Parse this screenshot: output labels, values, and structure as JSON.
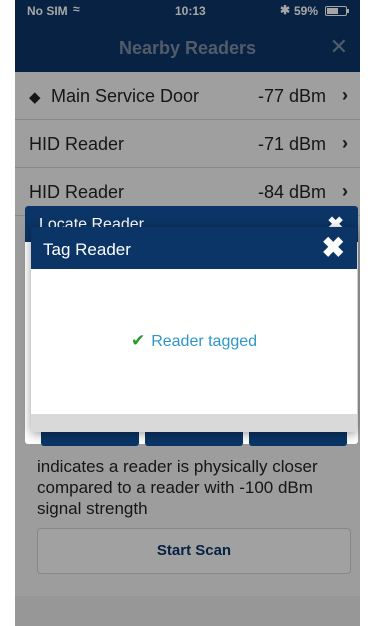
{
  "status_bar": {
    "carrier": "No SIM",
    "wifi_icon": "wifi-icon",
    "time": "10:13",
    "bluetooth_icon": "bluetooth-icon",
    "battery": "59%"
  },
  "header": {
    "title": "Nearby Readers",
    "close_icon": "close-icon"
  },
  "readers": [
    {
      "name": "Main Service Door",
      "signal": "-77 dBm",
      "tagged": true
    },
    {
      "name": "HID Reader",
      "signal": "-71 dBm",
      "tagged": false
    },
    {
      "name": "HID Reader",
      "signal": "-84 dBm",
      "tagged": false
    }
  ],
  "locate_panel": {
    "title": "Locate Reader"
  },
  "info_text": "indicates a reader is physically closer compared to a reader with -100 dBm signal strength",
  "scan_button": {
    "label": "Start Scan"
  },
  "dialog": {
    "title": "Tag Reader",
    "message": "Reader tagged",
    "close_icon": "close-icon",
    "check_icon": "checkmark-icon"
  },
  "colors": {
    "header_bg": "#0b3566",
    "accent_text": "#2e96c8",
    "check_green": "#2a9a2a"
  }
}
